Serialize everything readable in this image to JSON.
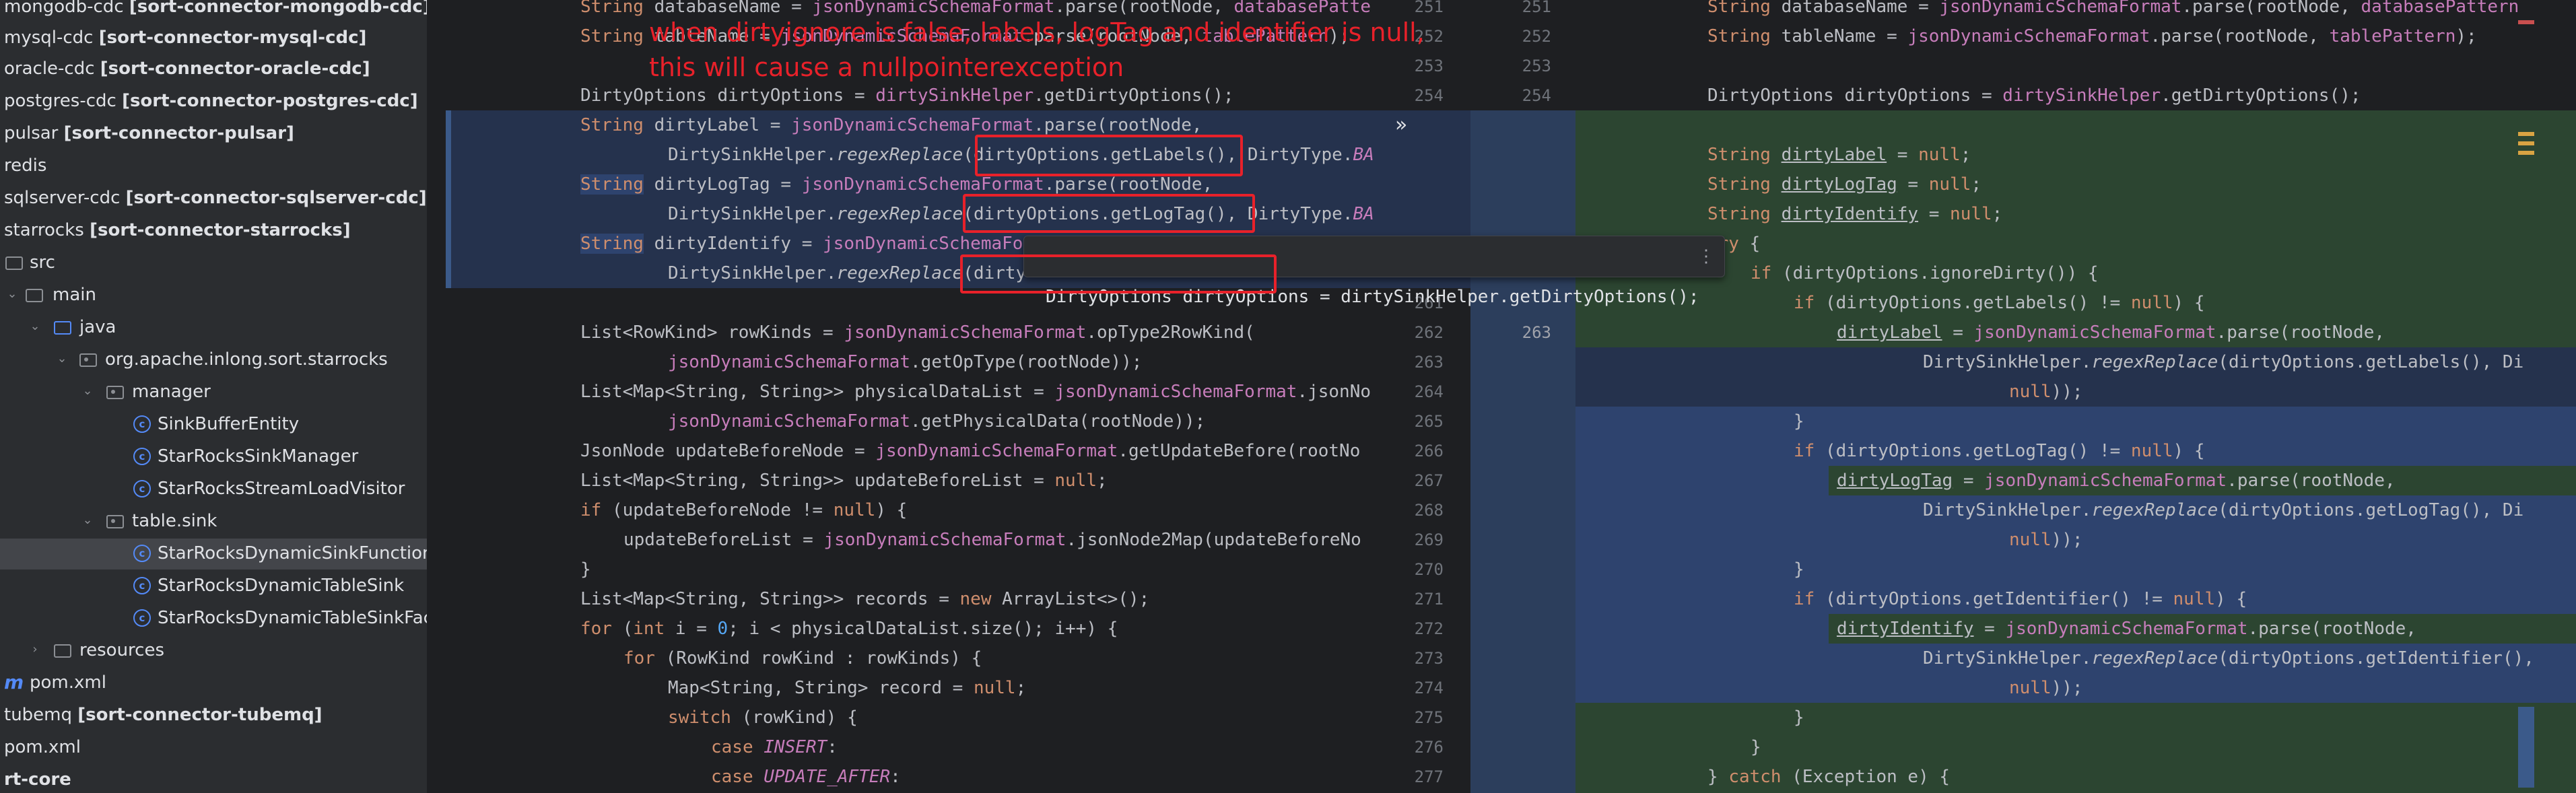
{
  "tree": {
    "items": [
      {
        "name": "mongodb-cdc",
        "module": "[sort-connector-mongodb-cdc]"
      },
      {
        "name": "mysql-cdc",
        "module": "[sort-connector-mysql-cdc]"
      },
      {
        "name": "oracle-cdc",
        "module": "[sort-connector-oracle-cdc]"
      },
      {
        "name": "postgres-cdc",
        "module": "[sort-connector-postgres-cdc]"
      },
      {
        "name": "pulsar",
        "module": "[sort-connector-pulsar]"
      },
      {
        "name": "redis",
        "module": ""
      },
      {
        "name": "sqlserver-cdc",
        "module": "[sort-connector-sqlserver-cdc]"
      },
      {
        "name": "starrocks",
        "module": "[sort-connector-starrocks]"
      },
      {
        "name": "src",
        "module": ""
      },
      {
        "name": "main",
        "module": ""
      },
      {
        "name": "java",
        "module": ""
      },
      {
        "name": "org.apache.inlong.sort.starrocks",
        "module": ""
      },
      {
        "name": "manager",
        "module": ""
      },
      {
        "name": "SinkBufferEntity",
        "module": ""
      },
      {
        "name": "StarRocksSinkManager",
        "module": ""
      },
      {
        "name": "StarRocksStreamLoadVisitor",
        "module": ""
      },
      {
        "name": "table.sink",
        "module": ""
      },
      {
        "name": "StarRocksDynamicSinkFunction",
        "module": ""
      },
      {
        "name": "StarRocksDynamicTableSink",
        "module": ""
      },
      {
        "name": "StarRocksDynamicTableSinkFact",
        "module": ""
      },
      {
        "name": "resources",
        "module": ""
      },
      {
        "name": "pom.xml",
        "module": ""
      },
      {
        "name": "tubemq",
        "module": "[sort-connector-tubemq]"
      },
      {
        "name": "pom.xml",
        "module": ""
      },
      {
        "name": "rt-core",
        "module": ""
      }
    ]
  },
  "annotation": {
    "line1": "when dirtyignore is false, labels, logTag and identifier is null,",
    "line2": "this will cause a nullpointerexception"
  },
  "tooltip": {
    "text": "DirtyOptions dirtyOptions = dirtySinkHelper.getDirtyOptions();",
    "more": "⋮"
  },
  "gutter": {
    "left_numbers": [
      "251",
      "252",
      "253",
      "254",
      "",
      "",
      "",
      "",
      "",
      "",
      "261",
      "262",
      "263",
      "264",
      "265",
      "266",
      "267",
      "268",
      "269",
      "270",
      "271",
      "272",
      "273",
      "274",
      "275",
      "276",
      "277"
    ],
    "right_numbers": [
      "251",
      "252",
      "253",
      "254",
      "",
      "",
      "",
      "",
      "",
      "",
      "",
      "",
      "263"
    ]
  },
  "colors": {
    "annotation": "#e8212a",
    "added_bg": "#2c4531",
    "changed_bg": "#25324d",
    "selection_bg": "#2e436e"
  },
  "icons": {
    "collapse": "chevron-right-double-icon",
    "class": "class-icon",
    "folder": "folder-icon",
    "maven": "maven-icon"
  }
}
